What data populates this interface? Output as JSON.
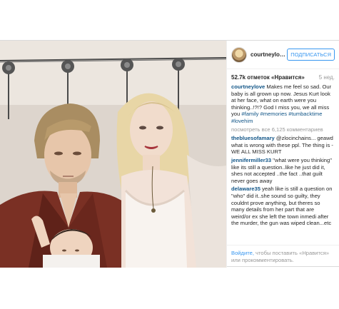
{
  "post": {
    "username": "courtneylo…",
    "follow_label": "ПОДПИСАТЬСЯ",
    "likes": "52.7k отметок «Нравится»",
    "time_ago": "5 нед.",
    "caption": {
      "user": "courtneylove",
      "text": "Makes me feel so sad. Our baby is all grown up now. Jesus Kurt look at her face, what on earth were you thinking..!?!? God I miss you, we all miss you",
      "tags": "#family #memories #tumbacktime #lovehim"
    },
    "view_all": "посмотреть все 6,125 комментариев",
    "comments": [
      {
        "user": "thebluesofamary",
        "text": "@zlocinchains... geawd what is wrong with these ppl. The thing is - WE ALL MISS KURT"
      },
      {
        "user": "jennifermiller33",
        "text": "\"what were you thinking\" like its still a question..like he just did it, shes not accepted ..the fact ..that guilt never goes away"
      },
      {
        "user": "delaware35",
        "text": "yeah like is still a question on \"who\" did it..she sound so guilty, they couldnt prove anything, but theres so many details from her part that are weird/or ex she left the town inmedi after the murder, the gun was wiped clean...etc"
      }
    ],
    "footer": {
      "login_link": "Войдите,",
      "login_rest": " чтобы поставить «Нравится» или прокомментировать."
    }
  }
}
